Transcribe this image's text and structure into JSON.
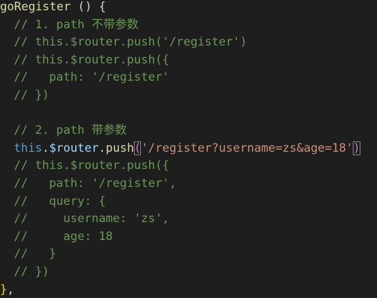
{
  "code": {
    "l1_fn": "goRegister",
    "l1_rest": " () {",
    "l2": "// 1. path 不带参数",
    "l3": "// this.$router.push('/register')",
    "l4": "// this.$router.push({",
    "l5": "//   path: '/register'",
    "l6": "// })",
    "l8": "// 2. path 带参数",
    "l9_this": "this",
    "l9_dot1": ".",
    "l9_router": "$router",
    "l9_dot2": ".",
    "l9_push": "push",
    "l9_open": "(",
    "l9_str": "'/register?username=zs&age=18'",
    "l9_close": ")",
    "l10": "// this.$router.push({",
    "l11": "//   path: '/register',",
    "l12": "//   query: {",
    "l13": "//     username: 'zs',",
    "l14": "//     age: 18",
    "l15": "//   }",
    "l16": "// })",
    "l17_brace": "}",
    "l17_comma": ","
  },
  "colors": {
    "background": "#1e1e1e",
    "comment": "#6a9955",
    "function": "#dcdcaa",
    "keyword": "#569cd6",
    "variable": "#9cdcfe",
    "string": "#ce9178",
    "bracket": "#da70d6"
  }
}
